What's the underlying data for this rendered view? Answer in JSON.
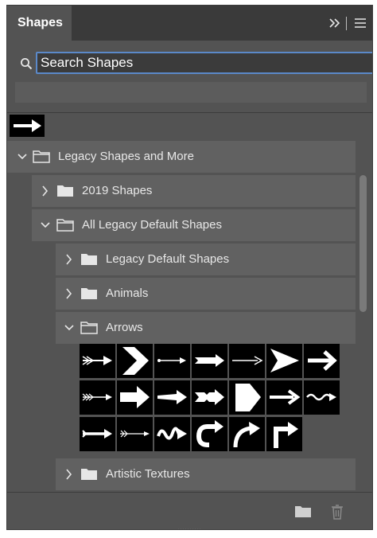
{
  "panel": {
    "title": "Shapes"
  },
  "search": {
    "placeholder": "Search Shapes",
    "value": ""
  },
  "tree": [
    {
      "label": "Legacy Shapes and More",
      "expanded": true
    },
    {
      "label": "2019 Shapes",
      "expanded": false
    },
    {
      "label": "All Legacy Default Shapes",
      "expanded": true
    },
    {
      "label": "Legacy Default Shapes",
      "expanded": false
    },
    {
      "label": "Animals",
      "expanded": false
    },
    {
      "label": "Arrows",
      "expanded": true
    },
    {
      "label": "Artistic Textures",
      "expanded": false
    }
  ],
  "icons": {
    "expand": "double-chevron-right-icon",
    "menu": "hamburger-menu-icon",
    "new_group": "folder-icon",
    "delete": "trash-icon"
  },
  "arrow_shapes": [
    "feathered-arrow",
    "chevron-arrow",
    "thin-arrow",
    "notched-arrow",
    "line-arrow",
    "dart-arrow",
    "bold-arrow",
    "fletched-arrow",
    "block-arrow",
    "wedge-arrow",
    "double-notch-arrow",
    "pentagon-arrow",
    "plain-arrow",
    "wavy-arrow",
    "tailed-arrow",
    "feather-line-arrow",
    "squiggle-arrow",
    "u-turn-arrow",
    "curved-arrow",
    "corner-arrow"
  ],
  "colors": {
    "panel": "#535353",
    "header": "#3a3a3a",
    "row": "#616161",
    "accent": "#5b89c9"
  }
}
